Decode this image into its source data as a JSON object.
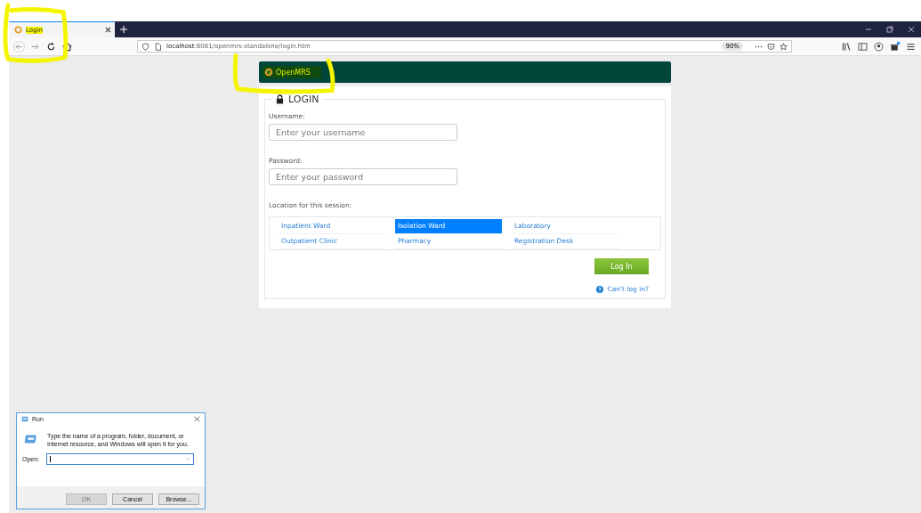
{
  "browser": {
    "tab": {
      "title": "Login"
    },
    "address": {
      "host": "localhost",
      "path": ":8081/openmrs-standalone/login.htm"
    },
    "zoom": "90%"
  },
  "header": {
    "logo": "OpenMRS"
  },
  "login": {
    "title": "LOGIN",
    "username": {
      "label": "Username:",
      "placeholder": "Enter your username"
    },
    "password": {
      "label": "Password:",
      "placeholder": "Enter your password"
    },
    "location_label": "Location for this session:",
    "locations": [
      {
        "name": "Inpatient Ward",
        "selected": false
      },
      {
        "name": "Isolation Ward",
        "selected": true
      },
      {
        "name": "Laboratory",
        "selected": false
      },
      {
        "name": "Outpatient Clinic",
        "selected": false
      },
      {
        "name": "Pharmacy",
        "selected": false
      },
      {
        "name": "Registration Desk",
        "selected": false
      }
    ],
    "submit": "Log In",
    "help_link": "Can't log in?"
  },
  "run_dialog": {
    "title": "Run",
    "message": "Type the name of a program, folder, document, or Internet resource, and Windows will open it for you.",
    "open_label": "Open:",
    "buttons": [
      {
        "label": "OK",
        "disabled": true
      },
      {
        "label": "Cancel",
        "disabled": false
      },
      {
        "label": "Browse...",
        "disabled": false
      }
    ]
  }
}
